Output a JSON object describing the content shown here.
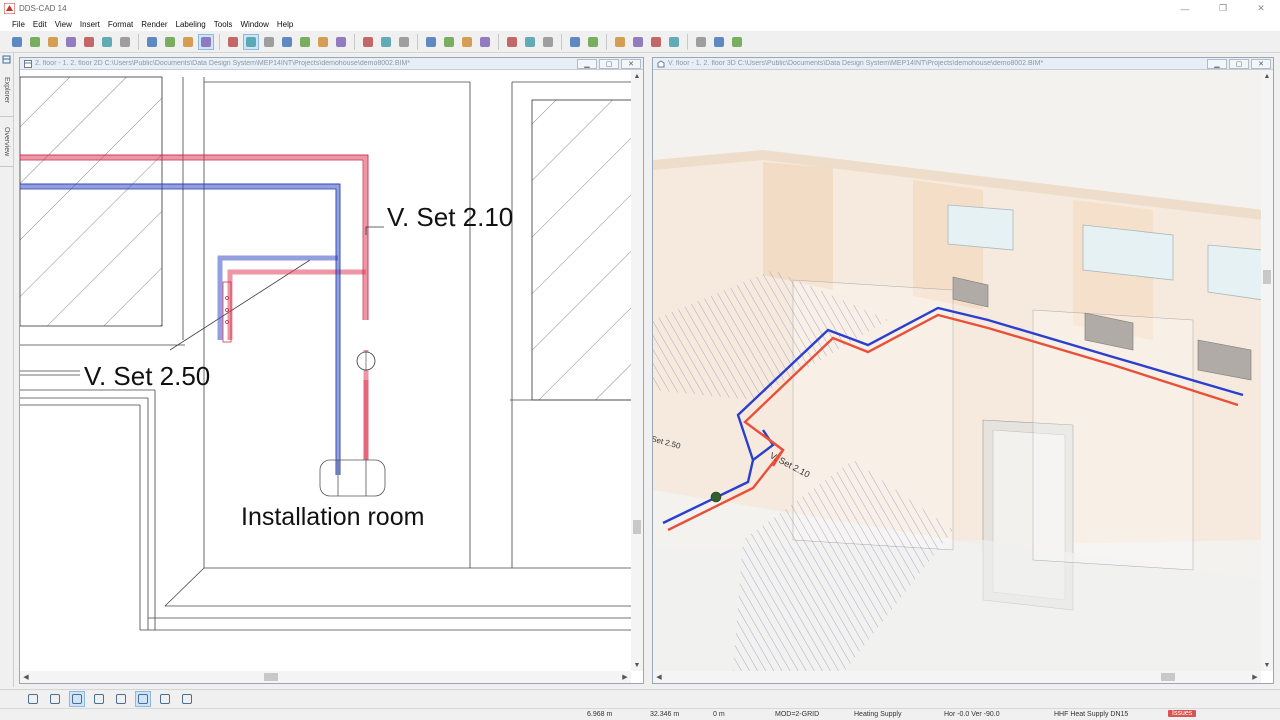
{
  "app": {
    "title": "DDS-CAD 14"
  },
  "window_controls": {
    "minimize": "—",
    "maximize": "❐",
    "close": "✕"
  },
  "menu": [
    "File",
    "Edit",
    "View",
    "Insert",
    "Format",
    "Render",
    "Labeling",
    "Tools",
    "Window",
    "Help"
  ],
  "toolbar": {
    "groups": [
      [
        "open-icon",
        "save-icon",
        "export-icon",
        "print-preview-icon",
        "print-icon",
        "undo-icon",
        "redo-icon"
      ],
      [
        "zoom-icon",
        "pan-icon",
        "render-icon",
        "select-icon"
      ],
      [
        "zoom-window-icon",
        "zoom-all-icon",
        "zoom-extents-icon",
        "zoom-previous-icon",
        "wireframe-icon",
        "view-eye-icon",
        "visibility-icon"
      ],
      [
        "section-icon",
        "layer-icon",
        "dimension-icon"
      ],
      [
        "pipe-route-icon",
        "connect-icon",
        "fitting-icon",
        "valve-icon"
      ],
      [
        "building-icon",
        "floor-icon",
        "storey-icon"
      ],
      [
        "calculate-icon",
        "report-icon"
      ],
      [
        "heating-icon",
        "flow-icon",
        "balance-icon",
        "check-icon"
      ],
      [
        "window-layout-icon",
        "image-icon",
        "settings-icon"
      ]
    ],
    "active": [
      "select-icon",
      "zoom-all-icon"
    ]
  },
  "left_tabs": [
    "Explorer",
    "Overview"
  ],
  "view2d": {
    "title": "2. floor - 1. 2. floor 2D  C:\\Users\\Public\\Documents\\Data Design System\\MEP14INT\\Projects\\demohouse\\demo8002.BIM*",
    "labels": {
      "vset210": "V. Set 2.10",
      "vset250": "V. Set 2.50",
      "room": "Installation room"
    }
  },
  "view3d": {
    "title": "V. floor - 1. 2. floor 3D  C:\\Users\\Public\\Documents\\Data Design System\\MEP14INT\\Projects\\demohouse\\demo8002.BIM*",
    "labels": {
      "vset210": "V. Set 2.10",
      "vset250": "Set 2.50"
    }
  },
  "bottom_tools": [
    "snap-icon",
    "grid-icon",
    "ortho-icon",
    "object-snap-icon",
    "polar-icon",
    "ucs-icon",
    "model-icon",
    "xref-icon"
  ],
  "status": {
    "x": "6.968 m",
    "y": "32.346 m",
    "z": "0 m",
    "mode": "MOD=2-GRID",
    "system": "Heating Supply",
    "angles": "Hor  -0.0 Ver -90.0",
    "component": "HHF Heat Supply DN15",
    "issues": "Issues"
  },
  "colors": {
    "supply": "#e0405a",
    "return": "#3a50c8",
    "accent": "#0078d7"
  }
}
